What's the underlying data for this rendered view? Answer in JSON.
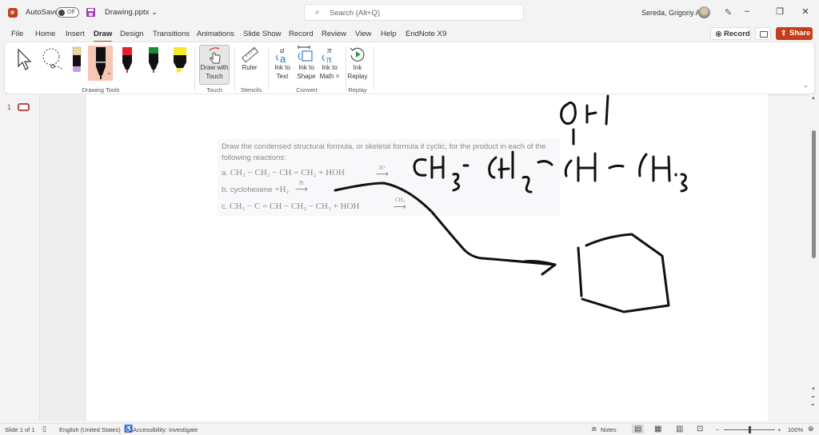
{
  "titlebar": {
    "autosave_label": "AutoSave",
    "autosave_state": "Off",
    "document_name": "Drawing.pptx",
    "doc_dropdown_icon": "chevron-down",
    "search_placeholder": "Search (Alt+Q)",
    "user_name": "Sereda, Grigoriy A",
    "minimize": "–",
    "restore": "❐",
    "close": "✕"
  },
  "menu": {
    "items": [
      "File",
      "Home",
      "Insert",
      "Draw",
      "Design",
      "Transitions",
      "Animations",
      "Slide Show",
      "Record",
      "Review",
      "View",
      "Help",
      "EndNote X9"
    ],
    "active": "Draw",
    "record_label": "Record",
    "share_label": "Share"
  },
  "ribbon": {
    "groups": {
      "drawing_tools": "Drawing Tools",
      "touch": "Touch",
      "stencils": "Stencils",
      "convert": "Convert",
      "replay": "Replay"
    },
    "pens": [
      {
        "name": "pencil-highlighter-purple",
        "color": "#c9a0dc"
      },
      {
        "name": "pen-black",
        "color": "#111111",
        "selected": true
      },
      {
        "name": "pen-red",
        "color": "#e0202a"
      },
      {
        "name": "pen-green",
        "color": "#1e8a3c"
      },
      {
        "name": "highlighter-yellow",
        "color": "#f5e92a"
      }
    ],
    "buttons": {
      "draw_with_touch_1": "Draw with",
      "draw_with_touch_2": "Touch",
      "ruler": "Ruler",
      "ink_to_text_1": "Ink to",
      "ink_to_text_2": "Text",
      "ink_to_shape_1": "Ink to",
      "ink_to_shape_2": "Shape",
      "ink_to_math_1": "Ink to",
      "ink_to_math_2": "Math ˅",
      "ink_replay_1": "Ink",
      "ink_replay_2": "Replay"
    }
  },
  "thumbnails": {
    "slide_number": "1"
  },
  "slide": {
    "problem_intro": "Draw the condensed structural formula, or skeletal formula if cyclic, for the product in each of the following reactions:",
    "reactions": [
      {
        "prefix": "a.",
        "formula": "CH₃ − CH₂ − CH = CH₂ + HOH",
        "arrow": "⟶",
        "catalyst": "H⁺"
      },
      {
        "prefix": "b.",
        "formula_text": "cyclohexene",
        "formula": "+H₂",
        "arrow": "⟶",
        "catalyst": "Pt"
      },
      {
        "prefix": "c.",
        "formula": "CH₃ − C = CH − CH₂ − CH₃ + HOH",
        "arrow": "⟶",
        "catalyst": "CH₃"
      }
    ],
    "handwritten_answer": "CH₃-CH₂-CH(OH)-CH₃"
  },
  "statusbar": {
    "slide_info": "Slide 1 of 1",
    "language": "English (United States)",
    "accessibility": "Accessibility: Investigate",
    "notes": "Notes",
    "zoom_minus": "−",
    "zoom_plus": "+",
    "zoom_level": "100%",
    "zoom_fraction": 0.5
  }
}
